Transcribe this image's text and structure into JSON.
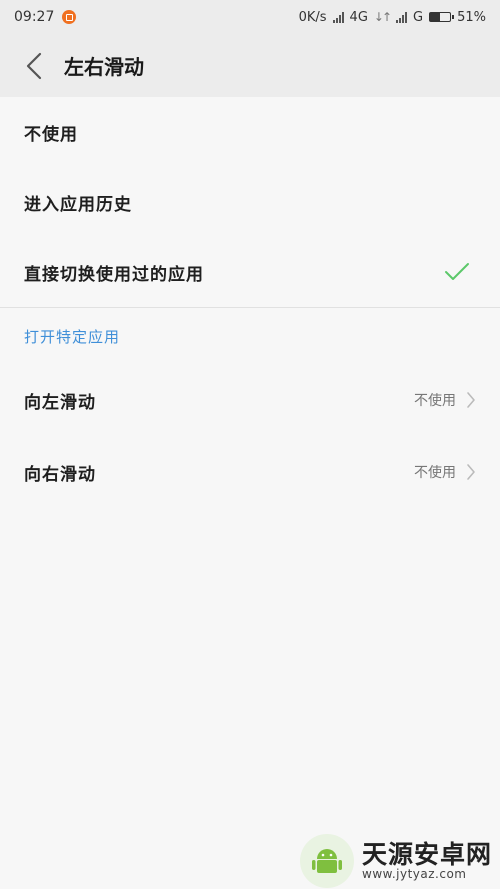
{
  "status_bar": {
    "time": "09:27",
    "net_speed": "0K/s",
    "network_type": "4G",
    "second_network": "G",
    "battery_percent": "51%",
    "battery_level": 0.51
  },
  "header": {
    "title": "左右滑动",
    "back_icon": "chevron-left-icon"
  },
  "options": [
    {
      "label": "不使用",
      "selected": false
    },
    {
      "label": "进入应用历史",
      "selected": false
    },
    {
      "label": "直接切换使用过的应用",
      "selected": true
    }
  ],
  "section": {
    "title": "打开特定应用",
    "items": [
      {
        "label": "向左滑动",
        "value": "不使用"
      },
      {
        "label": "向右滑动",
        "value": "不使用"
      }
    ]
  },
  "watermark": {
    "title": "天源安卓网",
    "url": "www.jytyaz.com"
  },
  "colors": {
    "accent": "#3f8fd8",
    "check": "#5cc86a",
    "header_bg": "#ececec",
    "page_bg": "#f7f7f7"
  }
}
